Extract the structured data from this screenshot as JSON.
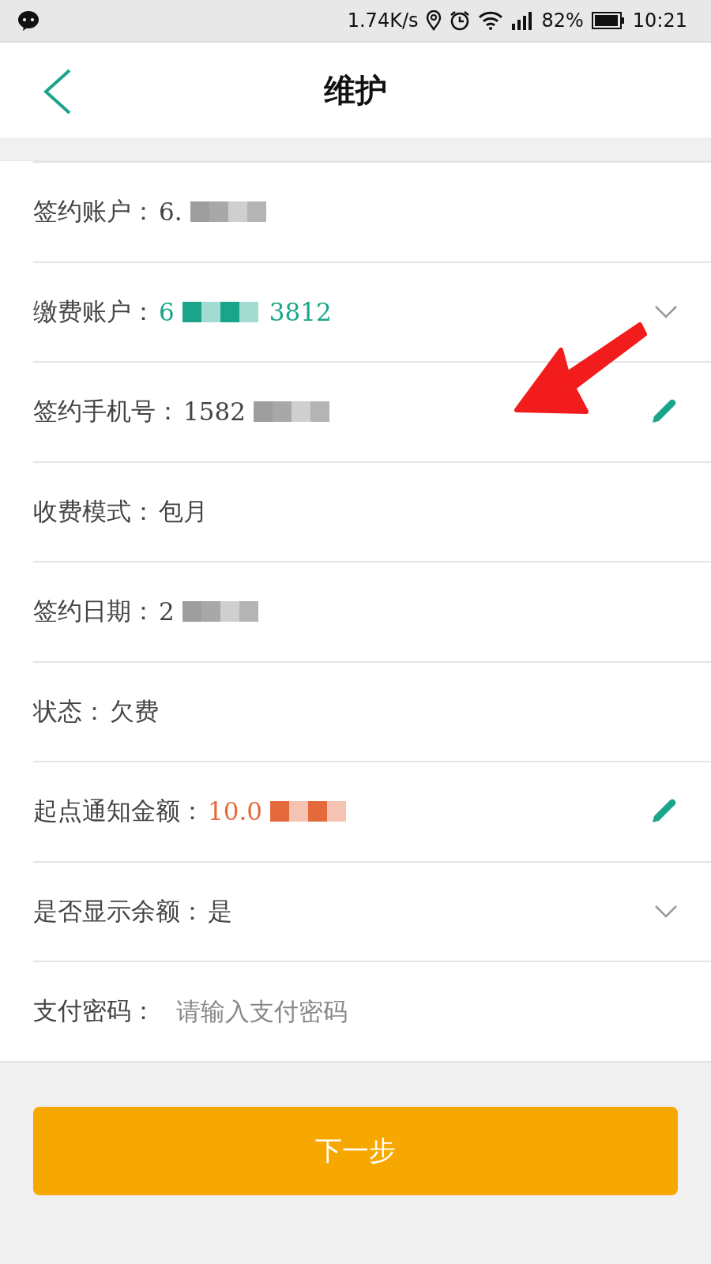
{
  "status_bar": {
    "speed": "1.74K/s",
    "battery": "82%",
    "time": "10:21"
  },
  "header": {
    "title": "维护"
  },
  "rows": [
    {
      "kind": "plain",
      "label": "签约账户：",
      "parts": [
        "6."
      ],
      "redacted": true
    },
    {
      "kind": "select",
      "label": "缴费账户：",
      "parts": [
        "6",
        "3812"
      ],
      "redacted": true,
      "color": "#1aa58a"
    },
    {
      "kind": "edit",
      "label": "签约手机号：",
      "parts": [
        "1582"
      ],
      "redacted": true
    },
    {
      "kind": "plain",
      "label": "收费模式：",
      "parts": [
        "包月"
      ],
      "redacted": false
    },
    {
      "kind": "plain",
      "label": "签约日期：",
      "parts": [
        "2"
      ],
      "redacted": true
    },
    {
      "kind": "plain",
      "label": "状态：",
      "parts": [
        "欠费"
      ],
      "redacted": false
    },
    {
      "kind": "edit",
      "label": "起点通知金额：",
      "parts": [
        "10.0"
      ],
      "redacted": true,
      "color": "#e46a3c"
    },
    {
      "kind": "select",
      "label": "是否显示余额：",
      "parts": [
        "是"
      ],
      "redacted": false
    },
    {
      "kind": "input",
      "label": "支付密码：",
      "placeholder": "请输入支付密码"
    }
  ],
  "next_button": {
    "label": "下一步"
  }
}
